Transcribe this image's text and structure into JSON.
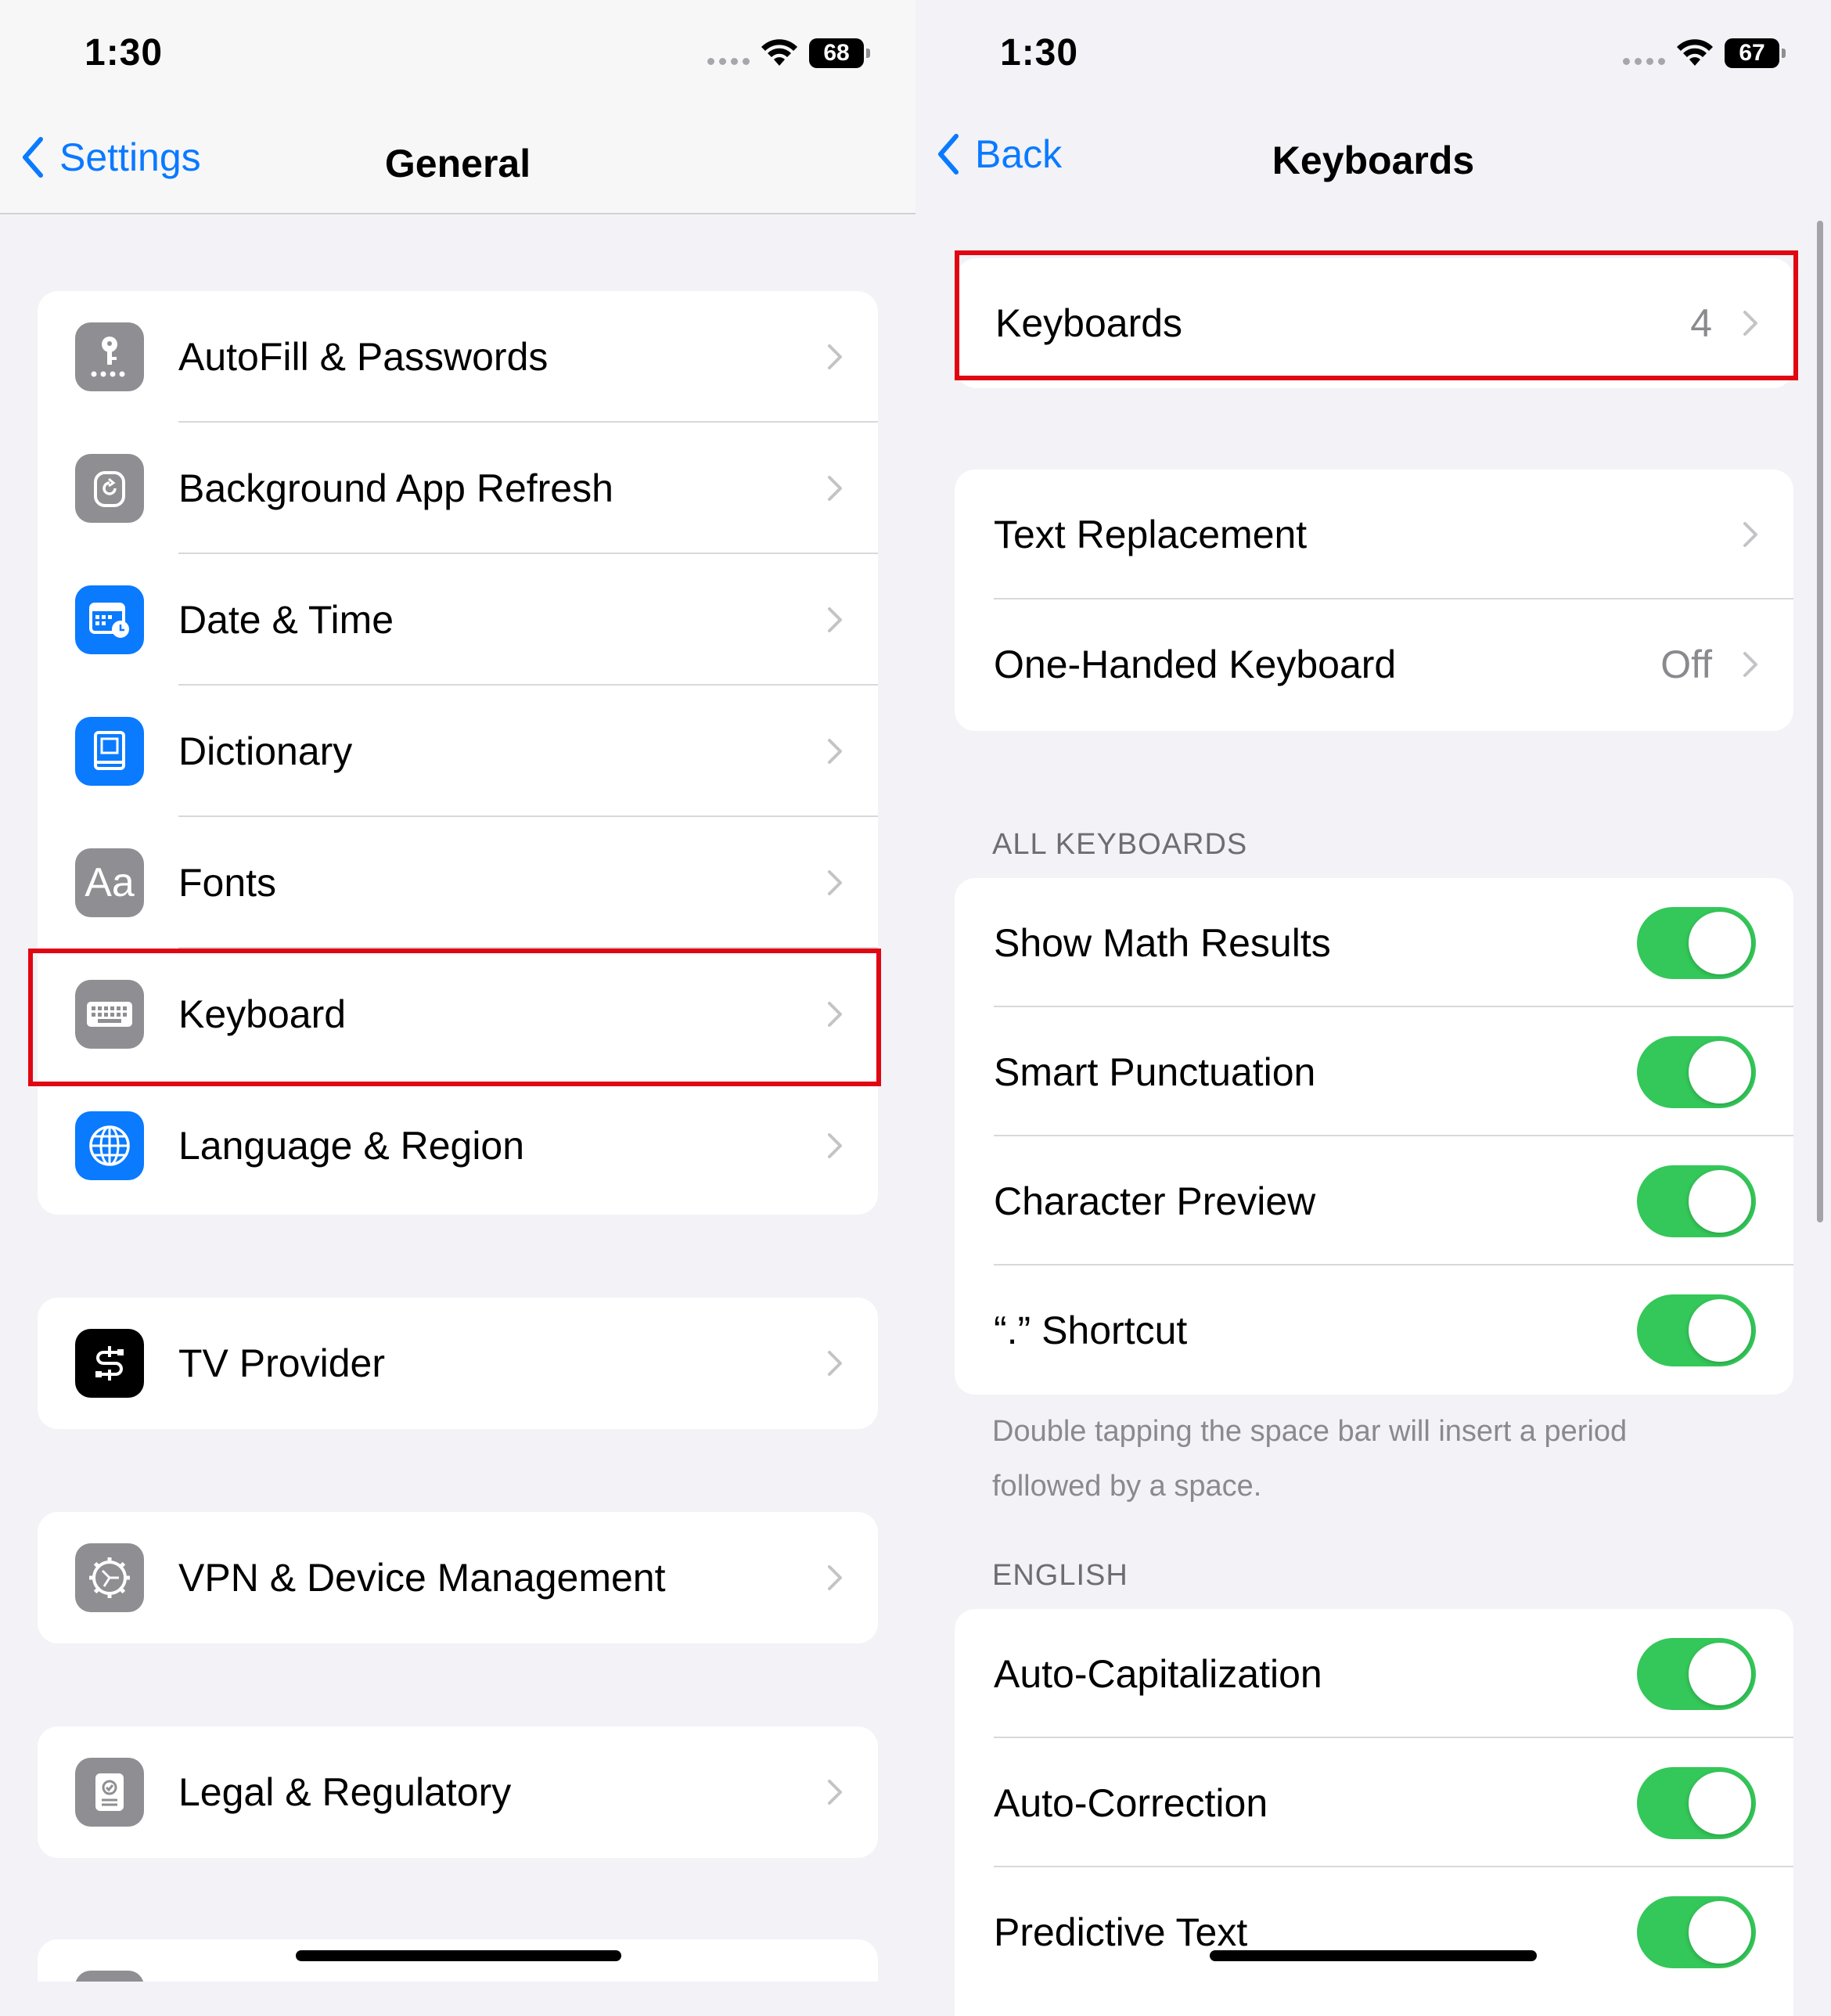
{
  "left": {
    "status": {
      "time": "1:30",
      "battery": "68"
    },
    "nav": {
      "back_label": "Settings",
      "title": "General"
    },
    "groups": [
      {
        "rows": [
          {
            "label": "AutoFill & Passwords",
            "icon": "key-icon",
            "icon_color": "#8e8e93"
          },
          {
            "label": "Background App Refresh",
            "icon": "refresh-icon",
            "icon_color": "#8e8e93"
          },
          {
            "label": "Date & Time",
            "icon": "calendar-clock-icon",
            "icon_color": "#0a7aff"
          },
          {
            "label": "Dictionary",
            "icon": "book-icon",
            "icon_color": "#0a7aff"
          },
          {
            "label": "Fonts",
            "icon": "fonts-icon",
            "icon_color": "#8e8e93",
            "icon_text": "Aa"
          },
          {
            "label": "Keyboard",
            "icon": "keyboard-icon",
            "icon_color": "#8e8e93"
          },
          {
            "label": "Language & Region",
            "icon": "globe-icon",
            "icon_color": "#0a7aff"
          }
        ]
      },
      {
        "rows": [
          {
            "label": "TV Provider",
            "icon": "tv-provider-icon",
            "icon_color": "#000000"
          }
        ]
      },
      {
        "rows": [
          {
            "label": "VPN & Device Management",
            "icon": "gear-icon",
            "icon_color": "#8e8e93"
          }
        ]
      },
      {
        "rows": [
          {
            "label": "Legal & Regulatory",
            "icon": "legal-icon",
            "icon_color": "#8e8e93"
          }
        ]
      }
    ]
  },
  "right": {
    "status": {
      "time": "1:30",
      "battery": "67"
    },
    "nav": {
      "back_label": "Back",
      "title": "Keyboards"
    },
    "keyboards_row": {
      "label": "Keyboards",
      "value": "4"
    },
    "group1": [
      {
        "label": "Text Replacement",
        "value": ""
      },
      {
        "label": "One-Handed Keyboard",
        "value": "Off"
      }
    ],
    "all_keyboards_header": "ALL KEYBOARDS",
    "all_keyboards": [
      {
        "label": "Show Math Results",
        "on": true
      },
      {
        "label": "Smart Punctuation",
        "on": true
      },
      {
        "label": "Character Preview",
        "on": true
      },
      {
        "label": "“.” Shortcut",
        "on": true
      }
    ],
    "shortcut_footnote": "Double tapping the space bar will insert a period followed by a space.",
    "english_header": "ENGLISH",
    "english": [
      {
        "label": "Auto-Capitalization",
        "on": true
      },
      {
        "label": "Auto-Correction",
        "on": true
      },
      {
        "label": "Predictive Text",
        "on": true
      }
    ]
  },
  "colors": {
    "accent": "#0a7aff",
    "toggle_on": "#34c759",
    "highlight": "#e00712"
  }
}
